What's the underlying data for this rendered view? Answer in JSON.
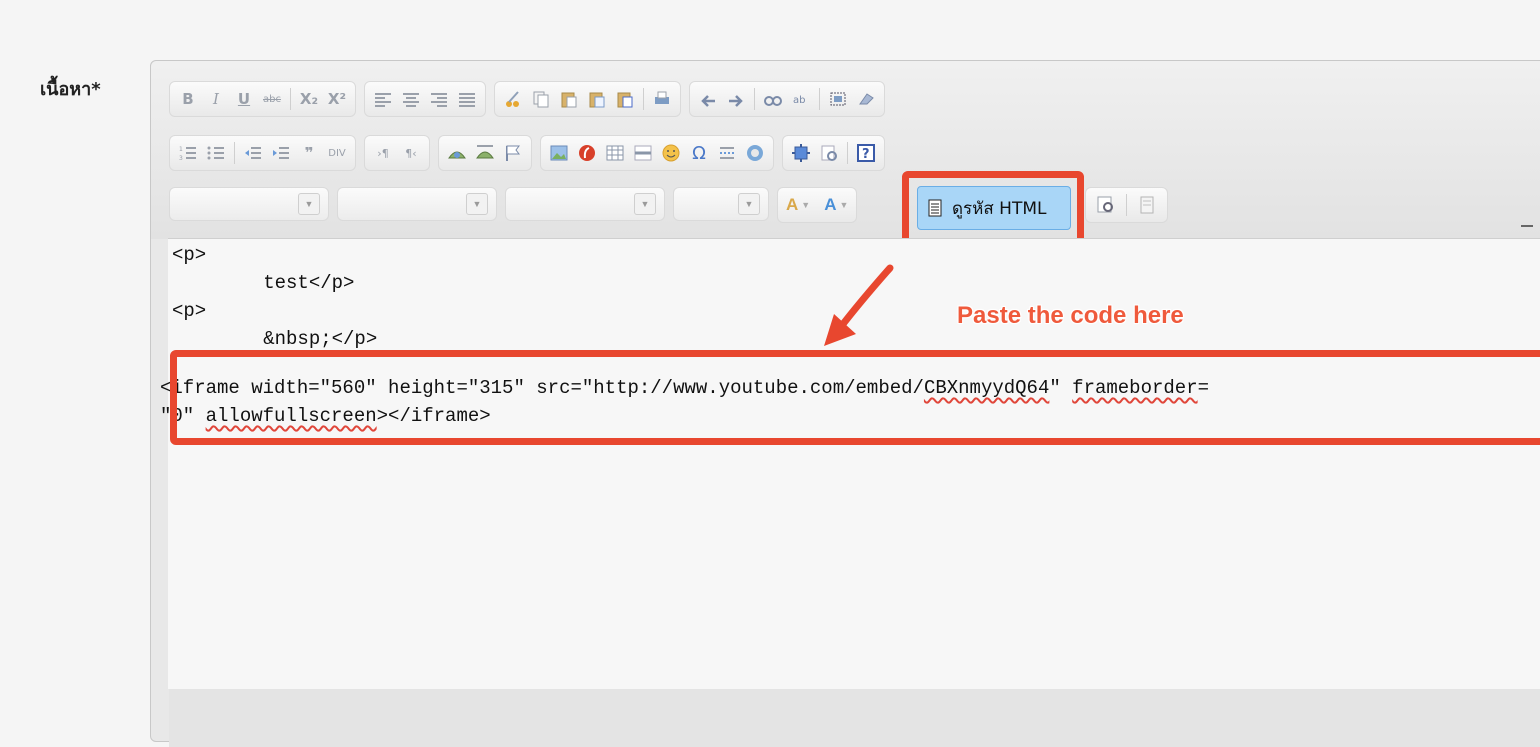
{
  "field": {
    "label": "เนื้อหา*"
  },
  "toolbar": {
    "row1": {
      "bold": "B",
      "italic": "I",
      "underline": "U",
      "strike": "abc",
      "subscript": "X₂",
      "superscript": "X²"
    },
    "source_button": {
      "label": "ดูรหัส HTML"
    }
  },
  "code": {
    "lines": [
      "<p>",
      "        test</p>",
      "<p>",
      "        &nbsp;</p>"
    ],
    "iframe_line1_a": "<iframe width=\"560\" height=\"315\" src=\"http://www.youtube.com/embed/",
    "iframe_line1_b": "CBXnmyydQ64",
    "iframe_line1_c": "\" ",
    "iframe_line1_d": "frameborder",
    "iframe_line1_e": "=",
    "iframe_line2_a": "\"0\" ",
    "iframe_line2_b": "allowfullscreen",
    "iframe_line2_c": "></iframe>"
  },
  "annotation": {
    "note": "Paste the code here",
    "color": "#e8472f"
  }
}
